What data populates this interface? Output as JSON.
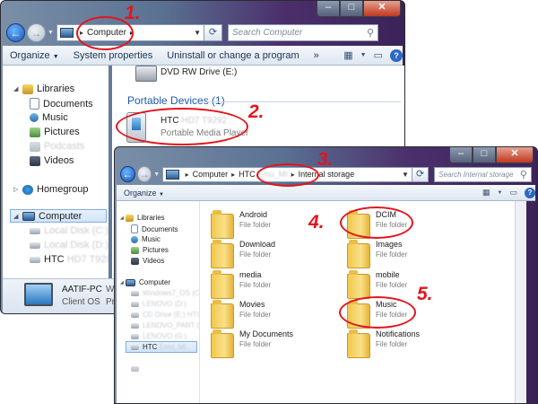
{
  "annotations": {
    "step1": "1.",
    "step2": "2.",
    "step3": "3.",
    "step4": "4.",
    "step5": "5."
  },
  "window1": {
    "address": {
      "crumb": "Computer"
    },
    "search_placeholder": "Search Computer",
    "toolbar": {
      "organize": "Organize",
      "system_properties": "System properties",
      "uninstall": "Uninstall or change a program"
    },
    "dvd_label": "DVD RW Drive (E:)",
    "portable_heading": "Portable Devices (1)",
    "device": {
      "name": "HTC",
      "name_blurred": "HD7 T9292",
      "type": "Portable Media Player"
    },
    "nav": {
      "libraries": "Libraries",
      "documents": "Documents",
      "music": "Music",
      "pictures": "Pictures",
      "podcasts": "Podcasts",
      "videos": "Videos",
      "homegroup": "Homegroup",
      "computer": "Computer",
      "local_disk_c": "Local Disk (C:)",
      "local_disk_d": "Local Disk (D:)",
      "htc": "HTC",
      "htc_blurred": "HD7 T9292"
    },
    "details": {
      "pc_name": "AATIF-PC",
      "workgroup_short": "Work",
      "os_label": "Client OS",
      "processor_short": "Pro"
    }
  },
  "window2": {
    "address": {
      "crumb1": "Computer",
      "crumb2": "HTC",
      "crumb2_blurred": "Emu_MI",
      "crumb3": "Internal storage"
    },
    "search_placeholder": "Search Internal storage",
    "toolbar": {
      "organize": "Organize"
    },
    "nav": {
      "libraries": "Libraries",
      "documents": "Documents",
      "music": "Music",
      "pictures": "Pictures",
      "videos": "Videos",
      "computer": "Computer",
      "drive1_blurred": "Windows7_OS (C:)",
      "drive2_blurred": "LENOVO (D:)",
      "drive3_blurred": "CD Drive (E:) HTC",
      "drive4_blurred": "LENOVO_PART (F:)",
      "drive5_blurred": "LENOVO (G:)",
      "htc": "HTC",
      "htc_blurred": "Emu_MI"
    },
    "folders": [
      {
        "name": "Android",
        "type": "File folder"
      },
      {
        "name": "DCIM",
        "type": "File folder"
      },
      {
        "name": "Download",
        "type": "File folder"
      },
      {
        "name": "Images",
        "type": "File folder"
      },
      {
        "name": "media",
        "type": "File folder"
      },
      {
        "name": "mobile",
        "type": "File folder"
      },
      {
        "name": "Movies",
        "type": "File folder"
      },
      {
        "name": "Music",
        "type": "File folder"
      },
      {
        "name": "My Documents",
        "type": "File folder"
      },
      {
        "name": "Notifications",
        "type": "File folder"
      }
    ]
  }
}
